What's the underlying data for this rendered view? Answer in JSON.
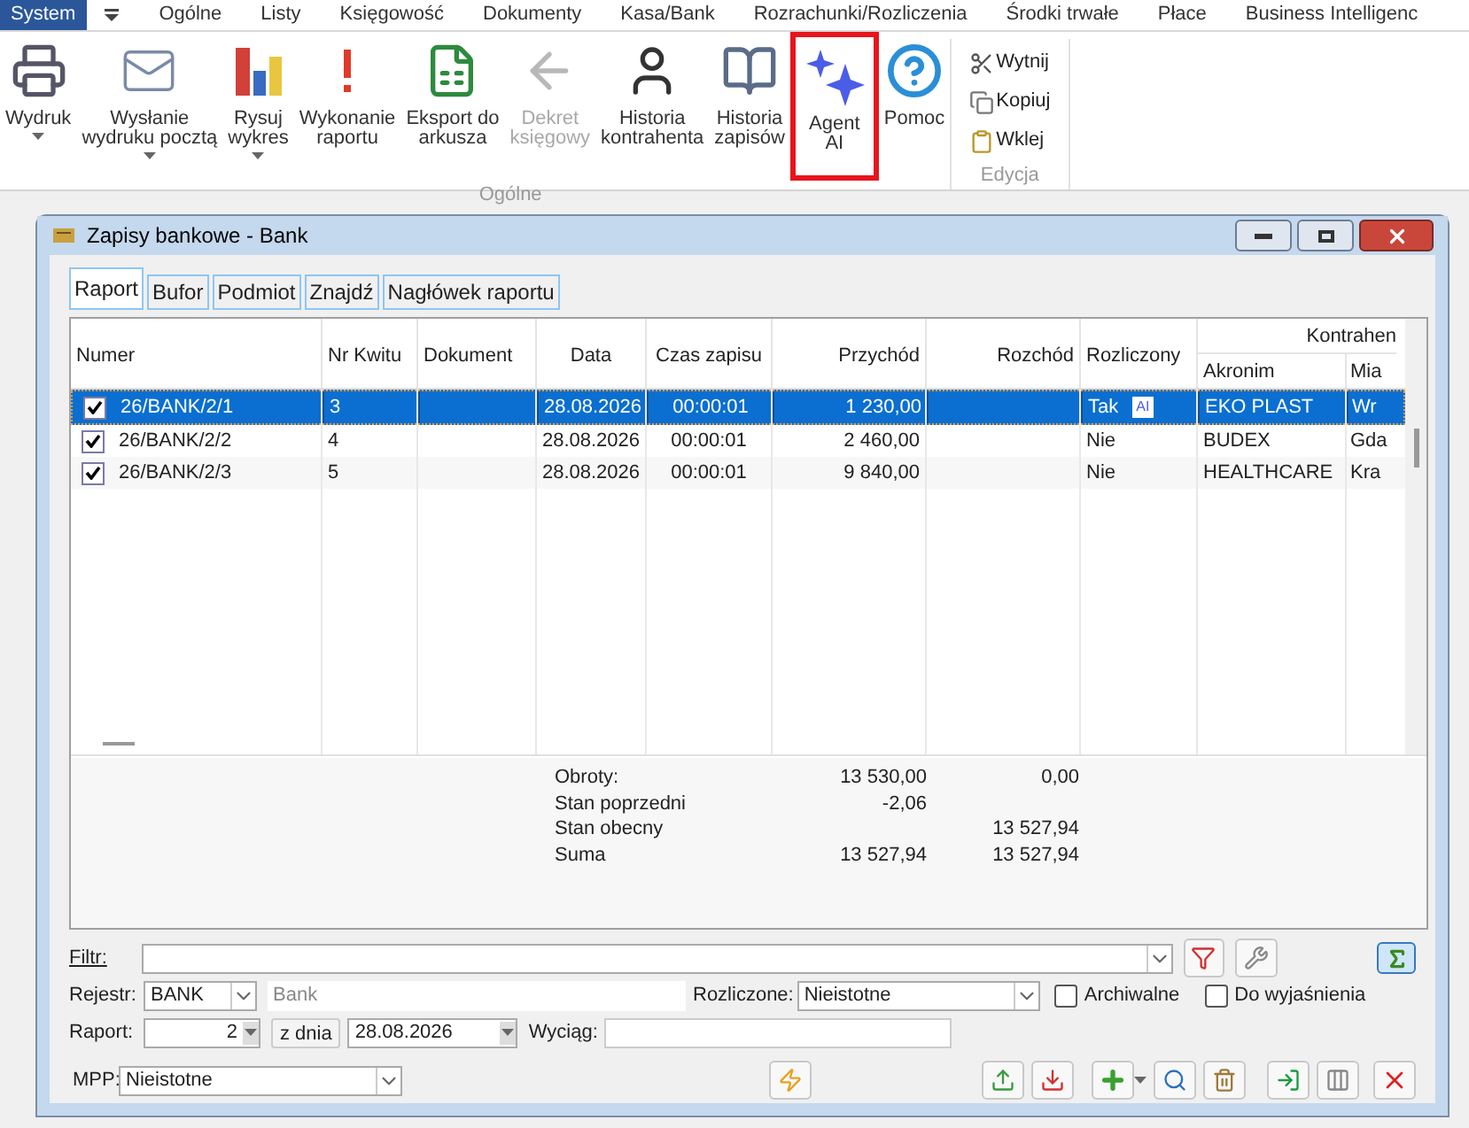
{
  "menu": [
    {
      "label": "System",
      "selected": true
    },
    {
      "label": "Ogólne",
      "selected": false
    },
    {
      "label": "Listy",
      "selected": false
    },
    {
      "label": "Księgowość",
      "selected": false
    },
    {
      "label": "Dokumenty",
      "selected": false
    },
    {
      "label": "Kasa/Bank",
      "selected": false
    },
    {
      "label": "Rozrachunki/Rozliczenia",
      "selected": false
    },
    {
      "label": "Środki trwałe",
      "selected": false
    },
    {
      "label": "Płace",
      "selected": false
    },
    {
      "label": "Business Intelligenc",
      "selected": false
    }
  ],
  "ribbon": {
    "groups": [
      {
        "label": "Ogólne",
        "buttons": [
          {
            "kind": "printer",
            "label": "Wydruk",
            "dropdown": true,
            "disabled": false
          },
          {
            "kind": "mail",
            "label": "Wysłanie\nwydruku pocztą",
            "dropdown": true,
            "disabled": false
          },
          {
            "kind": "chart",
            "label": "Rysuj\nwykres",
            "dropdown": true,
            "disabled": false
          },
          {
            "kind": "exclaim",
            "label": "Wykonanie\nraportu",
            "dropdown": false,
            "disabled": false
          },
          {
            "kind": "sheet",
            "label": "Eksport do\narkusza",
            "dropdown": false,
            "disabled": false
          },
          {
            "kind": "post",
            "label": "Dekret\nksięgowy",
            "dropdown": false,
            "disabled": true
          },
          {
            "kind": "person",
            "label": "Historia\nkontrahenta",
            "dropdown": false,
            "disabled": false
          },
          {
            "kind": "book",
            "label": "Historia\nzapisów",
            "dropdown": false,
            "disabled": false
          },
          {
            "kind": "sparkle",
            "label": "Agent\nAI",
            "dropdown": false,
            "disabled": false,
            "highlighted": true
          },
          {
            "kind": "help",
            "label": "Pomoc",
            "dropdown": false,
            "disabled": false
          }
        ]
      },
      {
        "label": "Edycja",
        "small": [
          {
            "kind": "cut",
            "label": "Wytnij"
          },
          {
            "kind": "copy",
            "label": "Kopiuj"
          },
          {
            "kind": "paste",
            "label": "Wklej"
          }
        ]
      }
    ]
  },
  "window": {
    "title": "Zapisy bankowe - Bank"
  },
  "tabs": [
    {
      "label": "Raport",
      "selected": true
    },
    {
      "label": "Bufor",
      "selected": false
    },
    {
      "label": "Podmiot",
      "selected": false
    },
    {
      "label": "Znajdź",
      "selected": false
    },
    {
      "label": "Nagłówek raportu",
      "selected": false
    }
  ],
  "table": {
    "columns": [
      "Numer",
      "Nr Kwitu",
      "Dokument",
      "Data",
      "Czas zapisu",
      "Przychód",
      "Rozchód",
      "Rozliczony"
    ],
    "group": "Kontrahen",
    "subcolumns": [
      "Akronim",
      "Mia"
    ],
    "rows": [
      {
        "checked": true,
        "selected": true,
        "numer": "26/BANK/2/1",
        "nr_kwitu": "3",
        "data": "28.08.2026",
        "czas": "00:00:01",
        "przychod": "1 230,00",
        "rozliczony": "Tak",
        "ai_badge": "AI",
        "akronim": "EKO PLAST",
        "miasto": "Wr"
      },
      {
        "checked": true,
        "selected": false,
        "numer": "26/BANK/2/2",
        "nr_kwitu": "4",
        "data": "28.08.2026",
        "czas": "00:00:01",
        "przychod": "2 460,00",
        "rozliczony": "Nie",
        "akronim": "BUDEX",
        "miasto": "Gda"
      },
      {
        "checked": true,
        "selected": false,
        "numer": "26/BANK/2/3",
        "nr_kwitu": "5",
        "data": "28.08.2026",
        "czas": "00:00:01",
        "przychod": "9 840,00",
        "rozliczony": "Nie",
        "akronim": "HEALTHCARE",
        "miasto": "Kra"
      }
    ]
  },
  "summary": [
    {
      "label": "Obroty:",
      "przychod": "13 530,00",
      "rozchod": "0,00"
    },
    {
      "label": "Stan poprzedni",
      "przychod": "-2,06"
    },
    {
      "label": "Stan obecny",
      "rozchod": "13 527,94"
    },
    {
      "label": "Suma",
      "przychod": "13 527,94",
      "rozchod": "13 527,94"
    }
  ],
  "form": {
    "filtr_label": "Filtr:",
    "rejestr_label": "Rejestr:",
    "rejestr": "BANK",
    "rejestr_name": "Bank",
    "rozliczone_label": "Rozliczone:",
    "rozliczone": "Nieistotne",
    "archiwalne": {
      "label": "Archiwalne",
      "checked": false
    },
    "do_wyjasnienia": {
      "label": "Do wyjaśnienia",
      "checked": false
    },
    "raport_label": "Raport:",
    "raport": "2",
    "z_dnia": "z dnia",
    "data": "28.08.2026",
    "wyciag_label": "Wyciąg:",
    "mpp_label": "MPP:",
    "mpp": "Nieistotne"
  }
}
